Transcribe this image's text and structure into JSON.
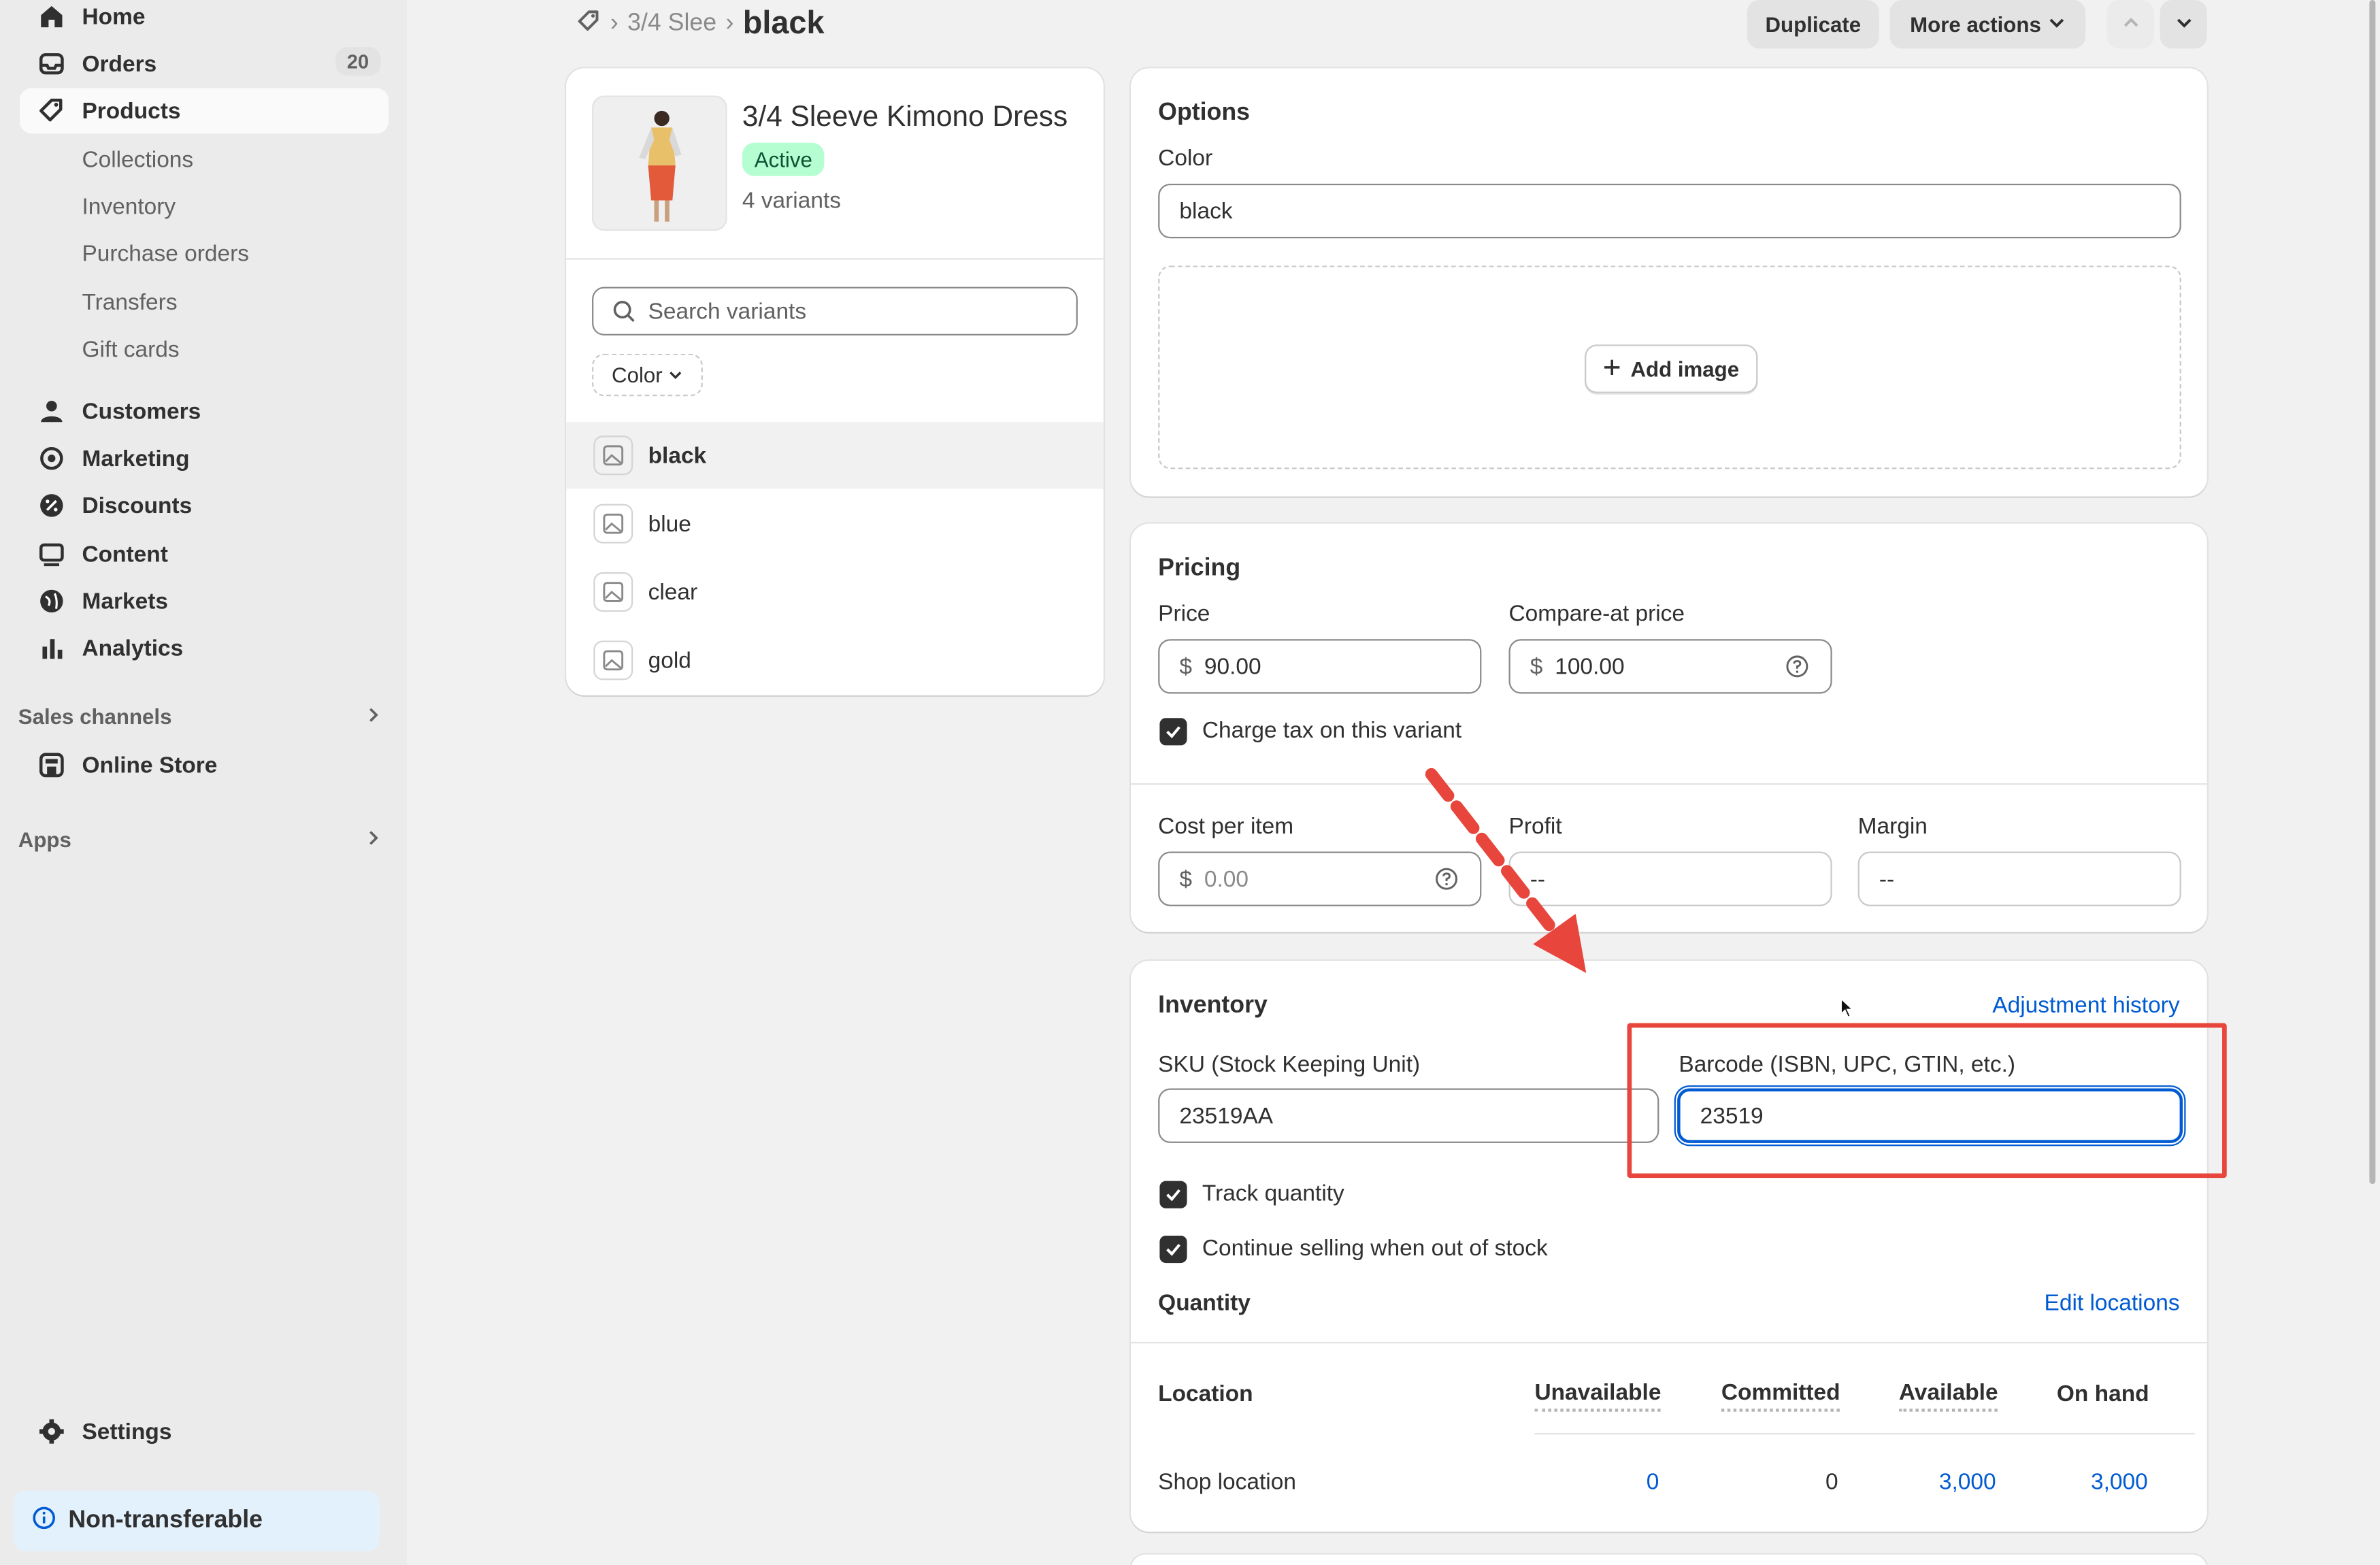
{
  "sidebar": {
    "items": [
      {
        "label": "Home",
        "icon": "home-icon"
      },
      {
        "label": "Orders",
        "icon": "orders-icon",
        "badge": "20"
      },
      {
        "label": "Products",
        "icon": "tag-icon"
      }
    ],
    "product_subitems": [
      "Collections",
      "Inventory",
      "Purchase orders",
      "Transfers",
      "Gift cards"
    ],
    "items2": [
      {
        "label": "Customers",
        "icon": "person-icon"
      },
      {
        "label": "Marketing",
        "icon": "target-icon"
      },
      {
        "label": "Discounts",
        "icon": "discount-icon"
      },
      {
        "label": "Content",
        "icon": "content-icon"
      },
      {
        "label": "Markets",
        "icon": "globe-icon"
      },
      {
        "label": "Analytics",
        "icon": "bar-chart-icon"
      }
    ],
    "sales_channels_label": "Sales channels",
    "online_store_label": "Online Store",
    "apps_label": "Apps",
    "settings_label": "Settings",
    "nontransferable_label": "Non-transferable"
  },
  "header": {
    "breadcrumb_parent": "3/4 Slee",
    "title": "black",
    "duplicate_label": "Duplicate",
    "more_actions_label": "More actions"
  },
  "product": {
    "name": "3/4 Sleeve Kimono Dress",
    "status": "Active",
    "variant_count": "4 variants",
    "search_placeholder": "Search variants",
    "filter_label": "Color",
    "variants": [
      "black",
      "blue",
      "clear",
      "gold"
    ]
  },
  "options": {
    "title": "Options",
    "color_label": "Color",
    "color_value": "black",
    "add_image_label": "Add image"
  },
  "pricing": {
    "title": "Pricing",
    "price_label": "Price",
    "price_value": "90.00",
    "compare_label": "Compare-at price",
    "compare_value": "100.00",
    "currency": "$",
    "charge_tax_label": "Charge tax on this variant",
    "cost_label": "Cost per item",
    "cost_placeholder": "0.00",
    "profit_label": "Profit",
    "profit_value": "--",
    "margin_label": "Margin",
    "margin_value": "--"
  },
  "inventory": {
    "title": "Inventory",
    "adjustment_history_label": "Adjustment history",
    "sku_label": "SKU (Stock Keeping Unit)",
    "sku_value": "23519AA",
    "barcode_label": "Barcode (ISBN, UPC, GTIN, etc.)",
    "barcode_value": "23519",
    "track_quantity_label": "Track quantity",
    "continue_selling_label": "Continue selling when out of stock",
    "quantity_label": "Quantity",
    "edit_locations_label": "Edit locations",
    "columns": [
      "Location",
      "Unavailable",
      "Committed",
      "Available",
      "On hand"
    ],
    "rows": [
      {
        "location": "Shop location",
        "unavailable": "0",
        "committed": "0",
        "available": "3,000",
        "on_hand": "3,000"
      }
    ]
  },
  "colors": {
    "accent_link": "#005bd3",
    "status_active_bg": "#b4fed2",
    "annotation_red": "#e8453c"
  }
}
